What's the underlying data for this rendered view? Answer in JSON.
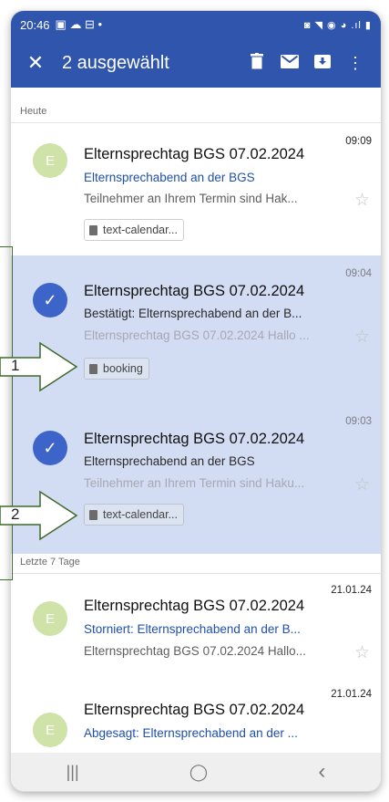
{
  "status_bar": {
    "time": "20:46",
    "left_icons": "▣ ☁ ⊟ •",
    "right_icons": "◙ ◥ ◉ ◕ .ıl ▮"
  },
  "app_bar": {
    "close": "✕",
    "title": "2 ausgewählt",
    "delete": "🗑",
    "mail": "✉",
    "move": "⬇",
    "more": "⋮"
  },
  "sections": {
    "today": "Heute",
    "last7": "Letzte 7 Tage"
  },
  "emails": [
    {
      "avatar": "E",
      "sender": "Elternsprechtag BGS 07.02.2024",
      "subject": "Elternsprechabend an der BGS",
      "snippet": "Teilnehmer an Ihrem Termin sind Hak...",
      "time": "09:09",
      "chip": "text-calendar..."
    },
    {
      "avatar": "✓",
      "sender": "Elternsprechtag BGS 07.02.2024",
      "subject": "Bestätigt: Elternsprechabend an der B...",
      "snippet": "Elternsprechtag BGS 07.02.2024 Hallo ...",
      "time": "09:04",
      "chip": "booking"
    },
    {
      "avatar": "✓",
      "sender": "Elternsprechtag BGS 07.02.2024",
      "subject": "Elternsprechabend an der BGS",
      "snippet": "Teilnehmer an Ihrem Termin sind Haku...",
      "time": "09:03",
      "chip": "text-calendar..."
    },
    {
      "avatar": "E",
      "sender": "Elternsprechtag BGS 07.02.2024",
      "subject": "Storniert: Elternsprechabend an der B...",
      "snippet": "Elternsprechtag BGS 07.02.2024 Hallo...",
      "time": "21.01.24"
    },
    {
      "avatar": "E",
      "sender": "Elternsprechtag BGS 07.02.2024",
      "subject": "Abgesagt: Elternsprechabend an der ...",
      "time": "21.01.24"
    }
  ],
  "star": "☆",
  "nav": {
    "recent": "|||",
    "home": "◯",
    "back": "‹"
  },
  "callouts": {
    "one": "1",
    "two": "2"
  },
  "colors": {
    "app_bar": "#2f55ad",
    "selected_row": "#d2dcf2",
    "check_avatar": "#3d64c8",
    "avatar_e": "#cfe2a8",
    "subject_link": "#1f4fae",
    "callout_green": "#3f6a2b"
  }
}
